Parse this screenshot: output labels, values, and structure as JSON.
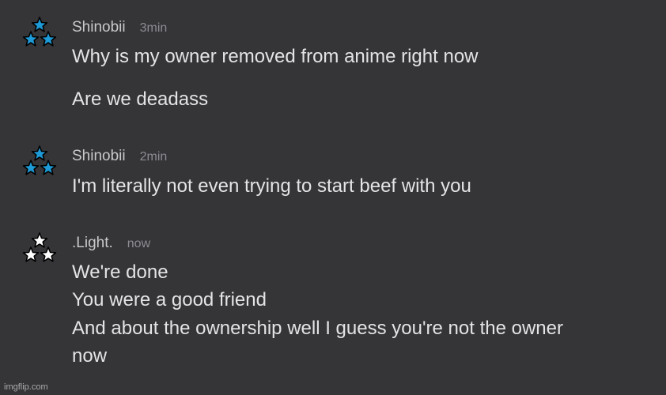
{
  "messages": [
    {
      "username": "Shinobii",
      "timestamp": "3min",
      "avatar_icon": "blue-stars-icon",
      "avatar_color": "#1e9ad6",
      "lines": [
        "Why is my owner removed from anime right now",
        "Are we deadass"
      ]
    },
    {
      "username": "Shinobii",
      "timestamp": "2min",
      "avatar_icon": "blue-stars-icon",
      "avatar_color": "#1e9ad6",
      "lines": [
        "I'm literally not even trying to start beef with you"
      ]
    },
    {
      "username": ".Light.",
      "timestamp": "now",
      "avatar_icon": "white-stars-icon",
      "avatar_color": "#ffffff",
      "lines": [
        "We're done",
        "You were a good friend",
        "And about the ownership well I guess you're not the owner",
        "now"
      ]
    }
  ],
  "watermark": "imgflip.com"
}
